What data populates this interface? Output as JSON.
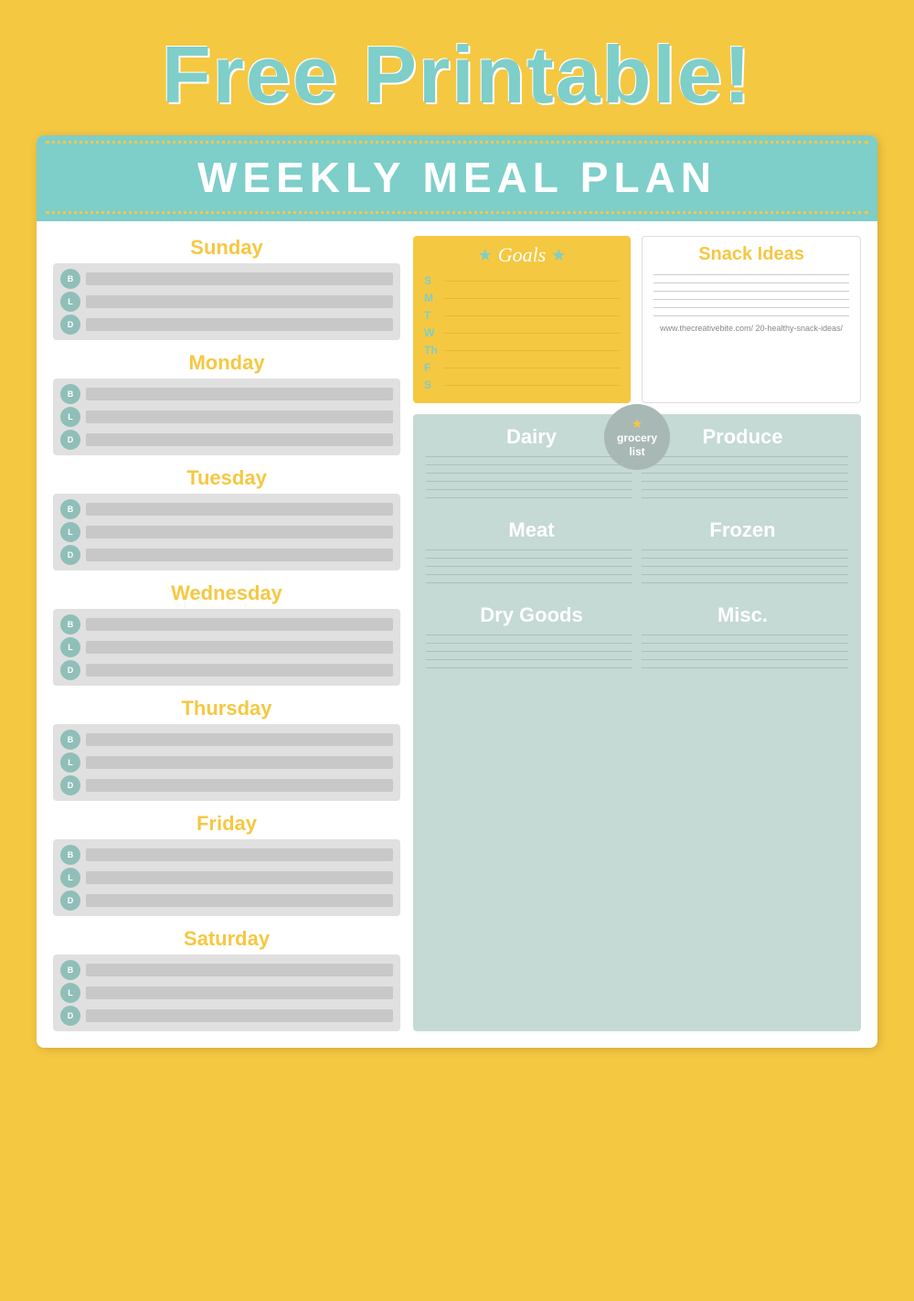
{
  "page": {
    "background_color": "#f5c842",
    "title": "Free Printable!",
    "card_title": "WEEKLY MEAL PLAN"
  },
  "days": [
    {
      "name": "Sunday",
      "meals": [
        "B",
        "L",
        "D"
      ]
    },
    {
      "name": "Monday",
      "meals": [
        "B",
        "L",
        "D"
      ]
    },
    {
      "name": "Tuesday",
      "meals": [
        "B",
        "L",
        "D"
      ]
    },
    {
      "name": "Wednesday",
      "meals": [
        "B",
        "L",
        "D"
      ]
    },
    {
      "name": "Thursday",
      "meals": [
        "B",
        "L",
        "D"
      ]
    },
    {
      "name": "Friday",
      "meals": [
        "B",
        "L",
        "D"
      ]
    },
    {
      "name": "Saturday",
      "meals": [
        "B",
        "L",
        "D"
      ]
    }
  ],
  "goals": {
    "title": "Goals",
    "days": [
      "S",
      "M",
      "T",
      "W",
      "Th",
      "F",
      "S"
    ]
  },
  "snack_ideas": {
    "title": "Snack Ideas",
    "lines": 6,
    "website": "www.thecreativebite.com/ 20-healthy-snack-ideas/"
  },
  "grocery": {
    "badge_star": "★",
    "badge_line1": "grocery",
    "badge_line2": "list",
    "sections": [
      {
        "label": "Dairy",
        "lines": 6
      },
      {
        "label": "Produce",
        "lines": 6
      },
      {
        "label": "Meat",
        "lines": 5
      },
      {
        "label": "Frozen",
        "lines": 5
      },
      {
        "label": "Dry Goods",
        "lines": 5
      },
      {
        "label": "Misc.",
        "lines": 5
      }
    ]
  }
}
